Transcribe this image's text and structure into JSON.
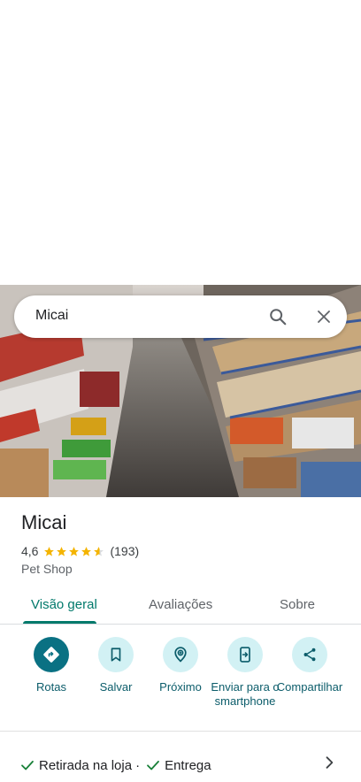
{
  "search": {
    "query": "Micai"
  },
  "place": {
    "name": "Micai",
    "rating": "4,6",
    "stars": 4.6,
    "reviews_count": "(193)",
    "category": "Pet Shop"
  },
  "tabs": [
    {
      "label": "Visão geral",
      "active": true
    },
    {
      "label": "Avaliações",
      "active": false
    },
    {
      "label": "Sobre",
      "active": false
    }
  ],
  "actions": [
    {
      "label": "Rotas",
      "icon": "directions-icon"
    },
    {
      "label": "Salvar",
      "icon": "bookmark-icon"
    },
    {
      "label": "Próximo",
      "icon": "nearby-icon"
    },
    {
      "label": "Enviar para o smartphone",
      "icon": "send-to-phone-icon"
    },
    {
      "label": "Compartilhar",
      "icon": "share-icon"
    }
  ],
  "services": {
    "pickup": "Retirada na loja",
    "separator": "·",
    "delivery": "Entrega"
  },
  "colors": {
    "accent": "#00796b",
    "action_primary": "#0a7183",
    "action_bg": "#d2f1f4",
    "star": "#f4b400"
  }
}
